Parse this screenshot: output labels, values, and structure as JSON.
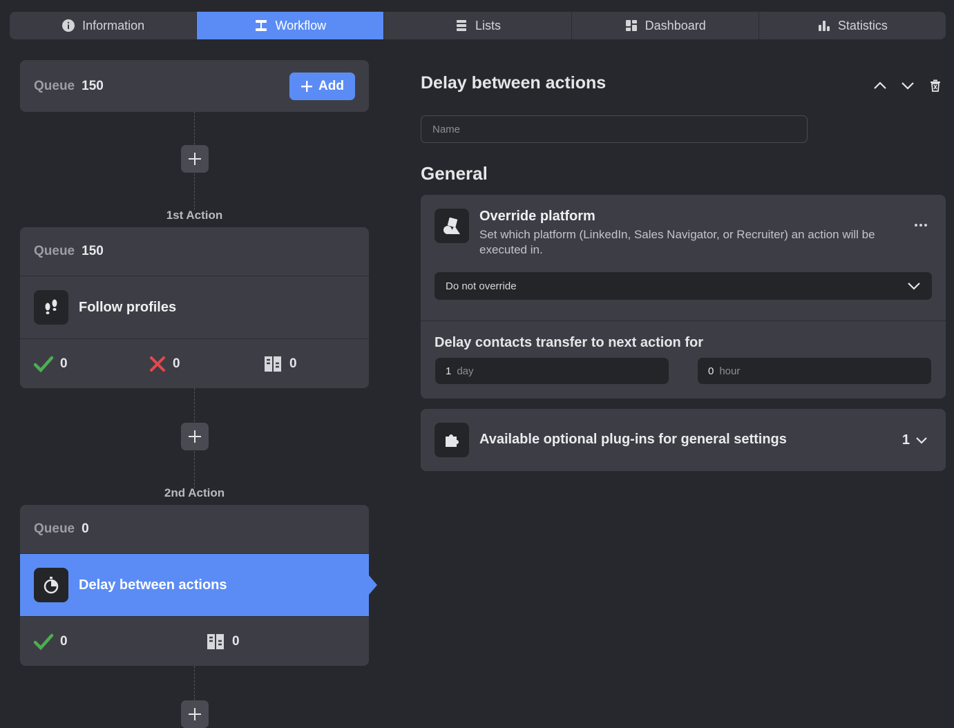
{
  "tabs": [
    {
      "label": "Information",
      "icon": "info-icon"
    },
    {
      "label": "Workflow",
      "icon": "workflow-icon"
    },
    {
      "label": "Lists",
      "icon": "lists-icon"
    },
    {
      "label": "Dashboard",
      "icon": "dashboard-icon"
    },
    {
      "label": "Statistics",
      "icon": "statistics-icon"
    }
  ],
  "active_tab": "Workflow",
  "workflow": {
    "start": {
      "queue_label": "Queue",
      "queue_value": "150",
      "add_label": "Add"
    },
    "actions": [
      {
        "step_label": "1st Action",
        "queue_label": "Queue",
        "queue_value": "150",
        "title": "Follow profiles",
        "icon": "footprints-icon",
        "stats": {
          "success": "0",
          "failed": "0",
          "skipped": "0"
        }
      },
      {
        "step_label": "2nd Action",
        "queue_label": "Queue",
        "queue_value": "0",
        "title": "Delay between actions",
        "icon": "stopwatch-icon",
        "stats": {
          "success": "0",
          "skipped": "0"
        }
      }
    ]
  },
  "panel": {
    "title": "Delay between actions",
    "name_placeholder": "Name",
    "section_title": "General",
    "override": {
      "title": "Override platform",
      "description": "Set which platform (LinkedIn, Sales Navigator, or Recruiter) an action will be executed in.",
      "selected": "Do not override"
    },
    "delay": {
      "title": "Delay contacts transfer to next action for",
      "day_value": "1",
      "day_unit": "day",
      "hour_value": "0",
      "hour_unit": "hour"
    },
    "plugins": {
      "title": "Available optional plug-ins for general settings",
      "count": "1"
    }
  },
  "colors": {
    "accent": "#5b8cf5",
    "success": "#4caf50",
    "error": "#e5484d"
  }
}
